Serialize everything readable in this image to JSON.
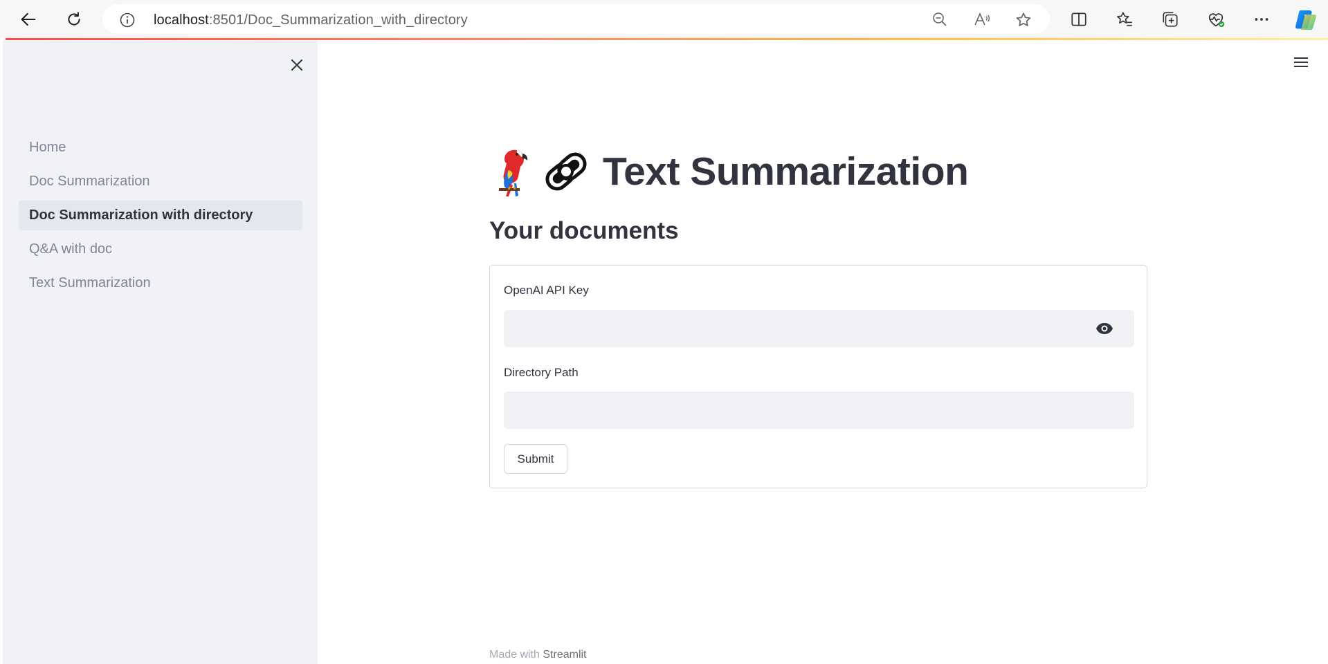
{
  "browser": {
    "url_host": "localhost",
    "url_path": ":8501/Doc_Summarization_with_directory"
  },
  "sidebar": {
    "items": [
      {
        "label": "Home",
        "active": false
      },
      {
        "label": "Doc Summarization",
        "active": false
      },
      {
        "label": "Doc Summarization with directory",
        "active": true
      },
      {
        "label": "Q&A with doc",
        "active": false
      },
      {
        "label": "Text Summarization",
        "active": false
      }
    ]
  },
  "main": {
    "title": "Text Summarization",
    "title_emojis": [
      "parrot-icon",
      "chain-link-icon"
    ],
    "subtitle": "Your documents",
    "form": {
      "api_key_label": "OpenAI API Key",
      "api_key_value": "",
      "directory_label": "Directory Path",
      "directory_value": "",
      "submit_label": "Submit"
    }
  },
  "footer": {
    "prefix": "Made with",
    "brand": "Streamlit"
  },
  "colors": {
    "accent": "#ff4b4b",
    "sidebar_bg": "#f0f2f6",
    "text": "#31333f",
    "muted": "#808495"
  }
}
